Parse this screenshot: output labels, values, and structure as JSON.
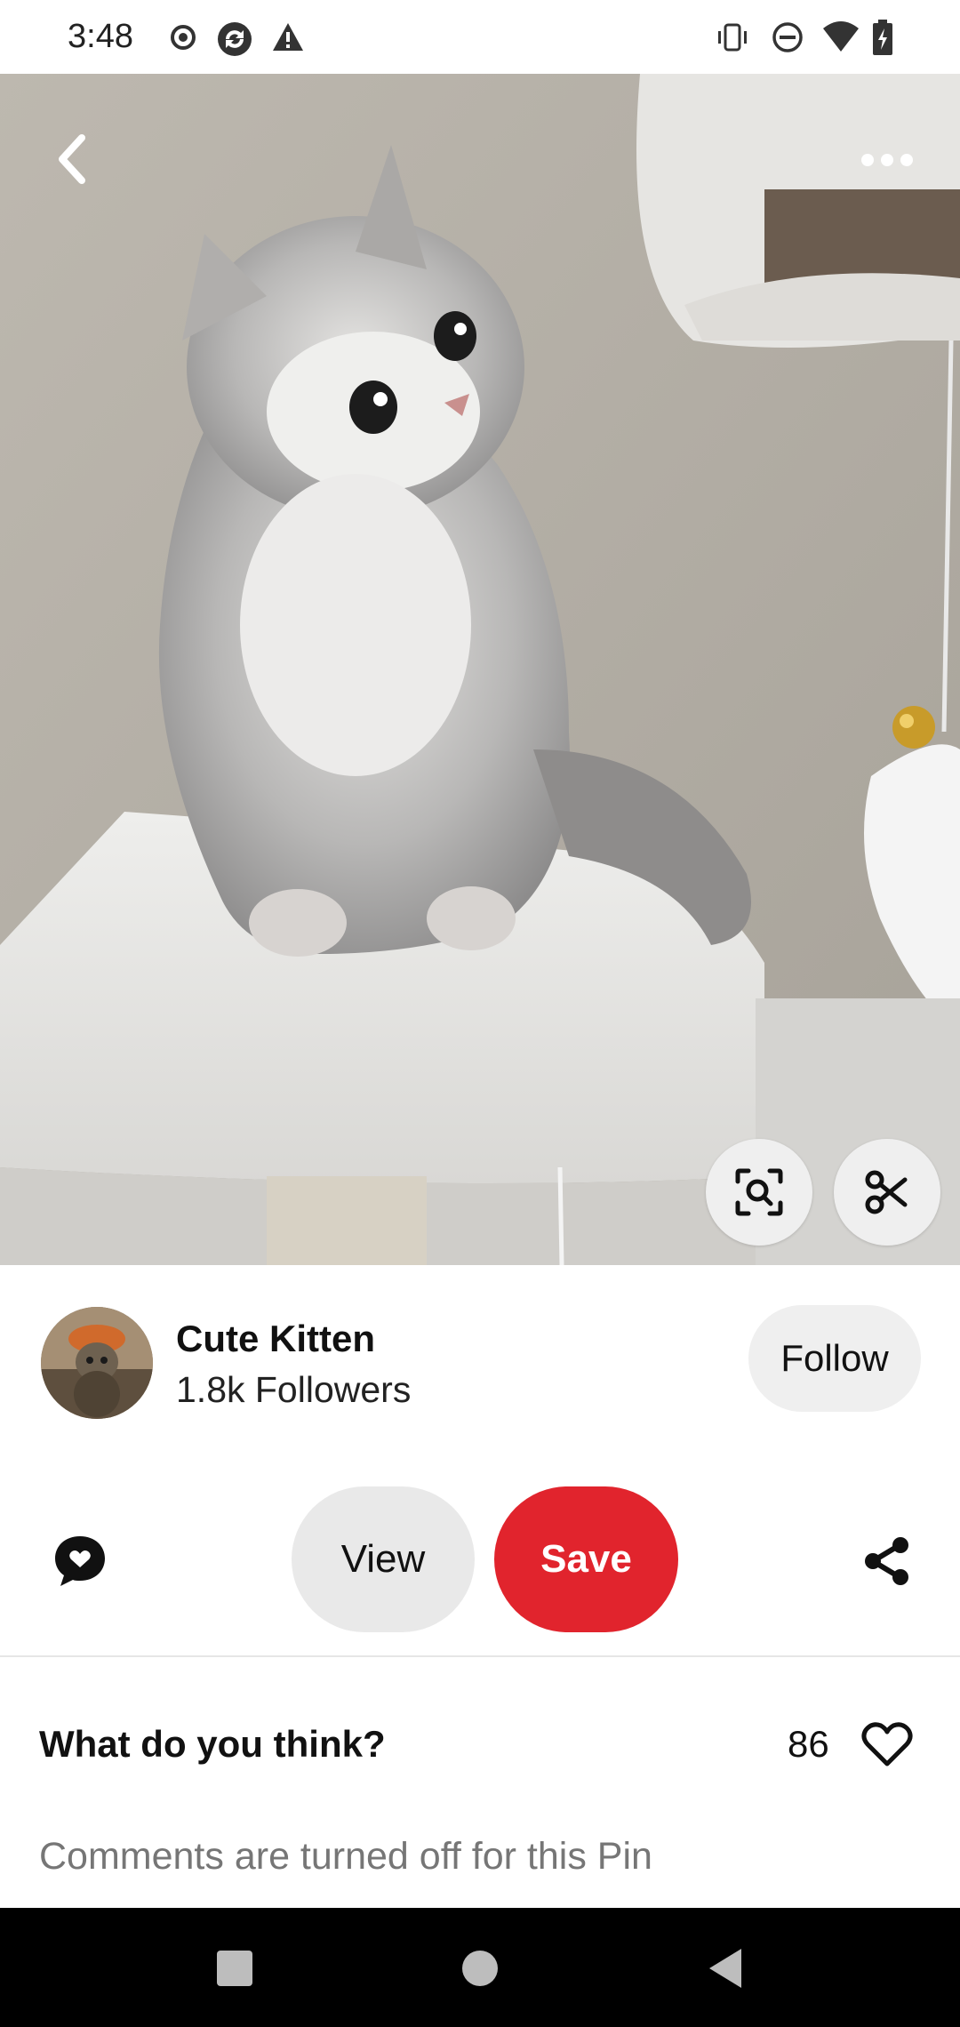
{
  "status_bar": {
    "time": "3:48",
    "left_icons": [
      "record-icon",
      "sync-icon",
      "alert-icon"
    ],
    "right_icons": [
      "vibrate-icon",
      "do-not-disturb-icon",
      "wifi-icon",
      "battery-charging-icon"
    ]
  },
  "pin": {
    "image_subject": "kitten-photo",
    "top_icons": {
      "back": "chevron-left-icon",
      "more": "more-horizontal-icon"
    },
    "overlay_buttons": [
      "visual-search-icon",
      "scissors-icon"
    ]
  },
  "creator": {
    "name": "Cute Kitten",
    "followers": "1.8k Followers",
    "follow_label": "Follow"
  },
  "actions": {
    "view_label": "View",
    "save_label": "Save",
    "comment_icon": "comment-bubble-icon",
    "share_icon": "share-icon"
  },
  "feedback": {
    "question": "What do you think?",
    "like_count": "86",
    "comments_status": "Comments are turned off for this Pin"
  },
  "nav_bar": {
    "buttons": [
      "recents-icon",
      "home-icon",
      "back-triangle-icon"
    ]
  },
  "colors": {
    "save_red": "#e1242d",
    "pill_gray": "#e9e9e9",
    "muted_text": "#767676"
  }
}
